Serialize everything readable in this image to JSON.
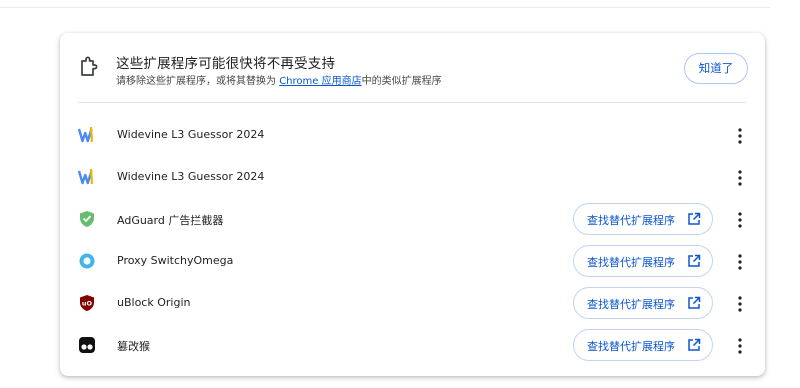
{
  "header": {
    "title": "这些扩展程序可能很快将不再受支持",
    "subtitle_before": "请移除这些扩展程序，或将其替换为 ",
    "store_link": "Chrome 应用商店",
    "subtitle_after": "中的类似扩展程序",
    "ok_button": "知道了",
    "icon": "extension-puzzle-icon"
  },
  "colors": {
    "accent": "#0b57d0",
    "text": "#1f1f1f",
    "divider": "#e3e3e3"
  },
  "extensions": [
    {
      "name": "Widevine L3 Guessor 2024",
      "icon": "widevine-w-icon",
      "find_button": null
    },
    {
      "name": "Widevine L3 Guessor 2024",
      "icon": "widevine-w-icon",
      "find_button": null
    },
    {
      "name": "AdGuard 广告拦截器",
      "icon": "adguard-shield-icon",
      "find_button": "查找替代扩展程序"
    },
    {
      "name": "Proxy SwitchyOmega",
      "icon": "switchyomega-circle-icon",
      "find_button": "查找替代扩展程序"
    },
    {
      "name": "uBlock Origin",
      "icon": "ublock-shield-icon",
      "find_button": "查找替代扩展程序"
    },
    {
      "name": "篡改猴",
      "icon": "tampermonkey-icon",
      "find_button": "查找替代扩展程序"
    }
  ]
}
